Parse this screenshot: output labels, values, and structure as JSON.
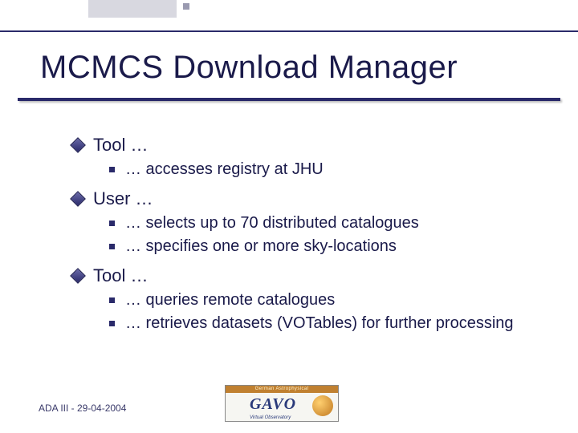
{
  "title": "MCMCS Download Manager",
  "sections": [
    {
      "heading": "Tool …",
      "items": [
        "… accesses registry at JHU"
      ]
    },
    {
      "heading": "User …",
      "items": [
        "… selects up to 70 distributed catalogues",
        "… specifies one or more sky-locations"
      ]
    },
    {
      "heading": "Tool …",
      "items": [
        "… queries remote catalogues",
        "… retrieves datasets (VOTables) for further processing"
      ]
    }
  ],
  "footer": "ADA III - 29-04-2004",
  "logo": {
    "band": "German Astrophysical",
    "name": "GAVO",
    "sub": "Virtual Observatory"
  }
}
